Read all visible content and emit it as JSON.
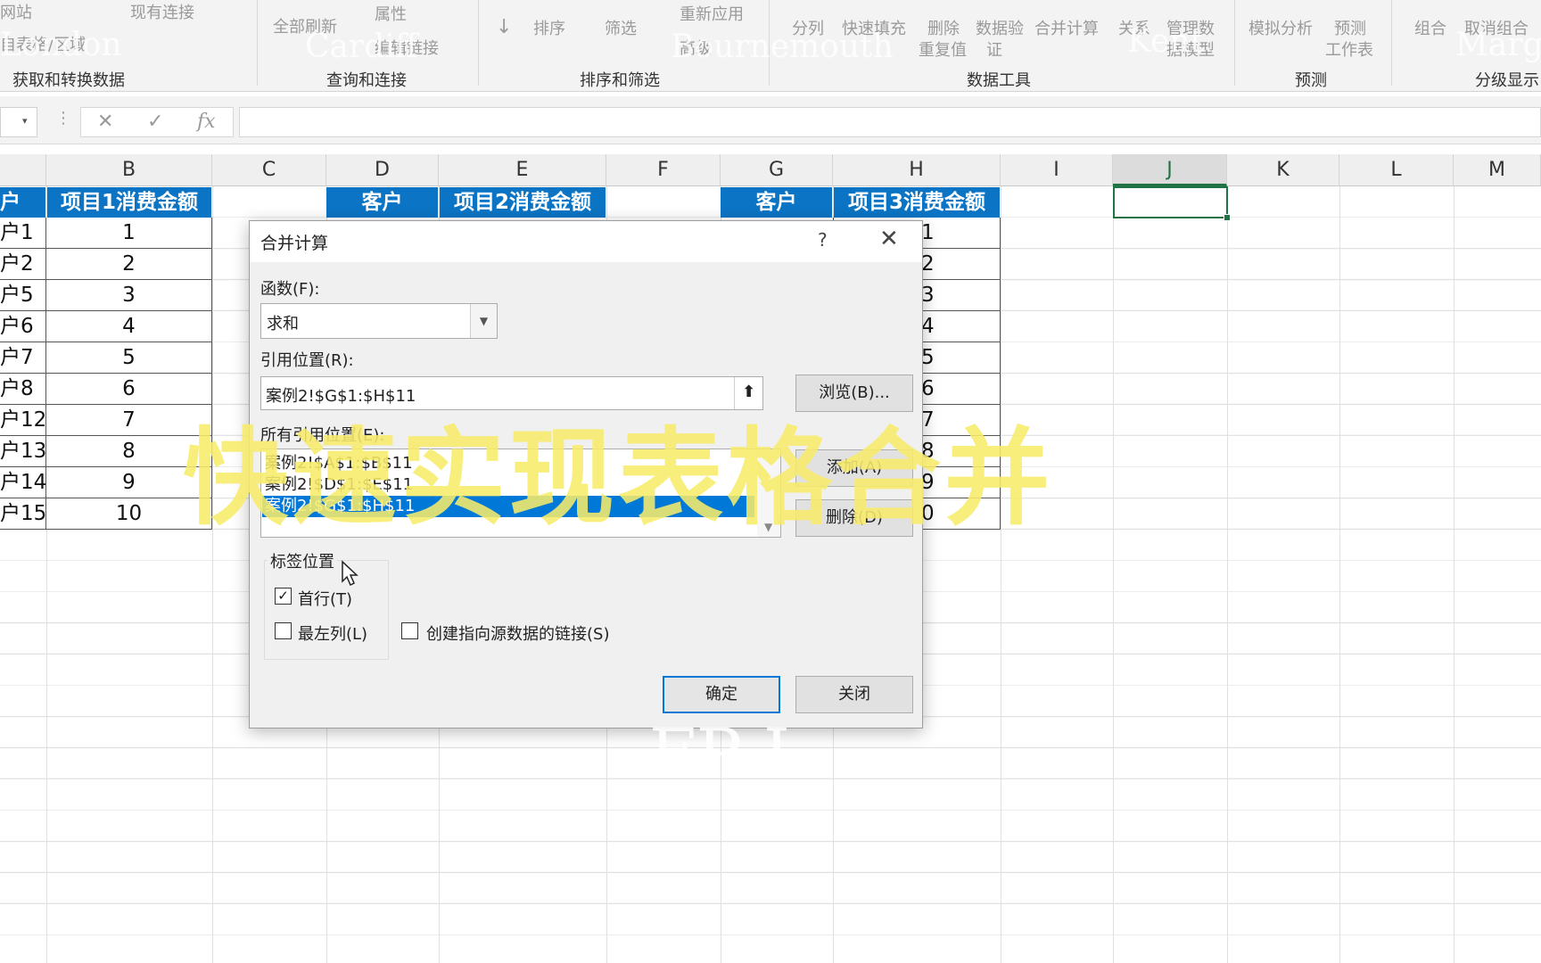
{
  "ribbon": {
    "items": {
      "website": "网站",
      "existing_conn": "现有连接",
      "table_range": "自表格/区域",
      "refresh_all": "全部刷新",
      "properties": "属性",
      "edit_links": "编辑链接",
      "sort": "排序",
      "filter": "筛选",
      "reapply": "重新应用",
      "advanced": "高级",
      "split": "分列",
      "flash_fill": "快速填充",
      "remove_dup": "删除",
      "remove_dup2": "重复值",
      "data_validation": "数据验",
      "data_validation2": "证",
      "consolidate": "合并计算",
      "relationships": "关系",
      "manage_model": "管理数",
      "manage_model2": "据模型",
      "what_if": "模拟分析",
      "forecast_sheet": "预测",
      "forecast_sheet2": "工作表",
      "group": "组合",
      "ungroup": "取消组合"
    },
    "groups": {
      "get_transform": "获取和转换数据",
      "queries": "查询和连接",
      "sort_filter": "排序和筛选",
      "data_tools": "数据工具",
      "forecast": "预测",
      "outline": "分级显示"
    },
    "ghost_words": [
      "London",
      "Cardiff",
      "Bournemouth",
      "Kent",
      "Marga"
    ]
  },
  "formula_bar": {
    "fx": "fx",
    "cancel": "✕",
    "enter": "✓",
    "value": ""
  },
  "columns": [
    "B",
    "C",
    "D",
    "E",
    "F",
    "G",
    "H",
    "I",
    "J",
    "K",
    "L",
    "M"
  ],
  "table1": {
    "header_a": "户",
    "header_b": "项目1消费金额",
    "col_a": [
      "户1",
      "户2",
      "户5",
      "户6",
      "户7",
      "户8",
      "户12",
      "户13",
      "户14",
      "户15"
    ],
    "values": [
      "1",
      "2",
      "3",
      "4",
      "5",
      "6",
      "7",
      "8",
      "9",
      "10"
    ]
  },
  "table2": {
    "header_d": "客户",
    "header_e": "项目2消费金额"
  },
  "table3": {
    "header_g": "客户",
    "header_h": "项目3消费金额",
    "visible_values": [
      "1",
      "2",
      "3",
      "4",
      "5",
      "6",
      "7",
      "8",
      "9",
      "0"
    ]
  },
  "dialog": {
    "title": "合并计算",
    "help": "?",
    "close": "✕",
    "function_label": "函数(F):",
    "function_value": "求和",
    "ref_label": "引用位置(R):",
    "ref_value": "案例2!$G$1:$H$11",
    "browse": "浏览(B)...",
    "all_refs_label": "所有引用位置(E):",
    "refs": [
      "案例2!$A$1:$B$11",
      "案例2!$D$1:$E$11",
      "案例2!$G$1:$H$11"
    ],
    "add": "添加(A)",
    "delete": "删除(D)",
    "label_pos": "标签位置",
    "top_row": "首行(T)",
    "left_col": "最左列(L)",
    "top_row_checked": true,
    "left_col_checked": false,
    "create_links": "创建指向源数据的链接(S)",
    "create_links_checked": false,
    "ok": "确定",
    "close_btn": "关闭"
  },
  "overlay_caption": "快速实现表格合并",
  "watermark": "FP I"
}
